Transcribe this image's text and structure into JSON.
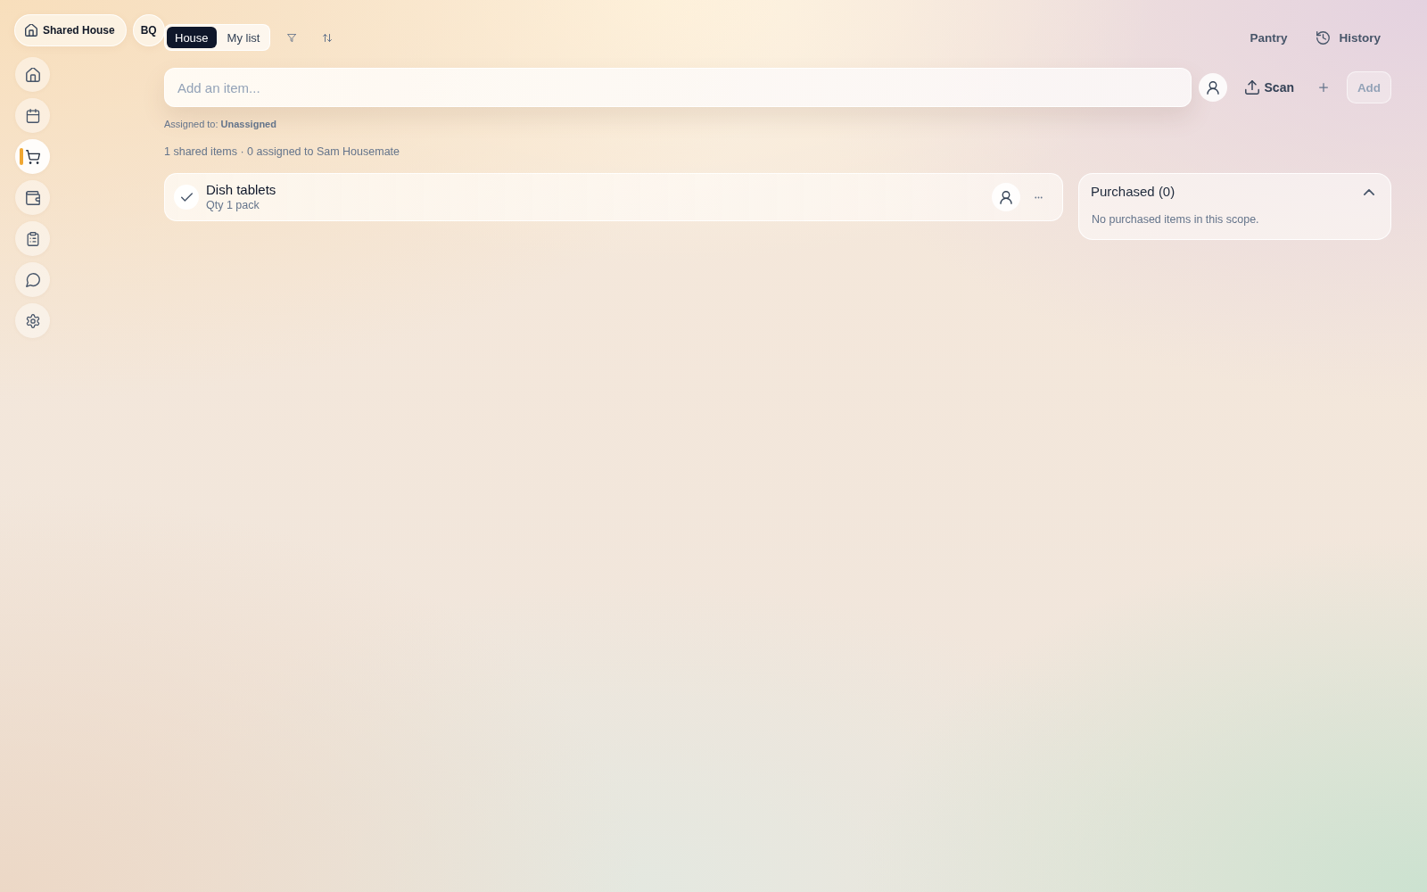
{
  "workspace": {
    "name": "Shared House",
    "avatar": "BQ"
  },
  "sidebar": {
    "items": [
      {
        "kind": "home",
        "selected": false
      },
      {
        "kind": "calendar",
        "selected": false
      },
      {
        "kind": "cart",
        "selected": true
      },
      {
        "kind": "wallet",
        "selected": false
      },
      {
        "kind": "clipboard",
        "selected": false
      },
      {
        "kind": "chat",
        "selected": false
      },
      {
        "kind": "settings",
        "selected": false
      }
    ]
  },
  "toolbar": {
    "scope_tabs": [
      {
        "label": "House",
        "selected": true
      },
      {
        "label": "My list",
        "selected": false
      }
    ],
    "actions": [
      {
        "kind": "plain",
        "label": "Pantry"
      },
      {
        "kind": "history",
        "label": "History"
      }
    ]
  },
  "add_item": {
    "placeholder": "Add an item...",
    "scan_label": "Scan",
    "add_button": {
      "label": "Add",
      "disabled": true
    },
    "assigned_to": "Assigned to: **Unassigned**"
  },
  "summary": "1 shared items · 0 assigned to Sam Housemate",
  "items": [
    {
      "name": "Dish tablets",
      "quantity": "Qty 1 pack"
    }
  ],
  "purchased": {
    "title": "Purchased (0)",
    "expanded": true,
    "empty_message": "No purchased items in this scope."
  }
}
